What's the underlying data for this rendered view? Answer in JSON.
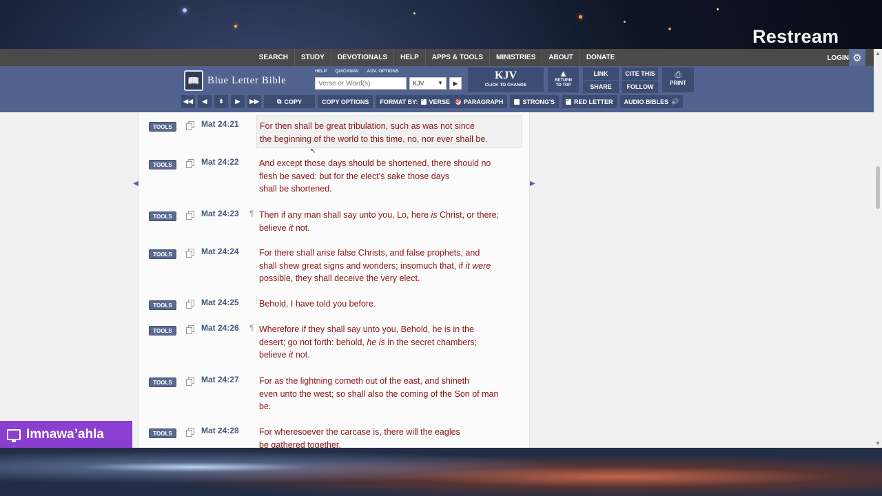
{
  "stream": {
    "brand": "Restream",
    "user_name": "Imnawa’ahla"
  },
  "nav": {
    "items": [
      "SEARCH",
      "STUDY",
      "DEVOTIONALS",
      "HELP",
      "APPS & TOOLS",
      "MINISTRIES",
      "ABOUT",
      "DONATE"
    ],
    "login": "LOGIN"
  },
  "header": {
    "logo_text": "Blue Letter Bible",
    "mini_links": [
      "HELP",
      "QUICKNAV",
      "ADV. OPTIONS"
    ],
    "search_placeholder": "Verse or Word(s)",
    "version_value": "KJV",
    "version_box": {
      "title": "KJV",
      "subtitle": "CLICK TO CHANGE"
    },
    "return_to_top": [
      "RETURN",
      "TO TOP"
    ],
    "link": "LINK",
    "share": "SHARE",
    "cite": "CITE THIS",
    "follow": "FOLLOW",
    "print": "PRINT"
  },
  "toolbar": {
    "copy": "COPY",
    "copy_options": "COPY OPTIONS",
    "format_by": "FORMAT BY:",
    "verse": "VERSE",
    "paragraph": "PARAGRAPH",
    "strongs": "STRONG'S",
    "red_letter": "RED LETTER",
    "audio_bibles": "AUDIO BIBLES"
  },
  "tools_label": "TOOLS",
  "verses": [
    {
      "ref": "Mat 24:21",
      "pilcrow": false,
      "lines": [
        "For then shall be great tribulation, such as was not since",
        "the beginning of the world to this time, no, nor ever shall be."
      ]
    },
    {
      "ref": "Mat 24:22",
      "pilcrow": false,
      "lines": [
        "And except those days should be shortened, there should no",
        "flesh be saved: but for the elect's sake those days",
        "shall be shortened."
      ]
    },
    {
      "ref": "Mat 24:23",
      "pilcrow": true,
      "lines": [
        "Then if any man shall say unto you, Lo, here <i>is</i> Christ, or there;",
        "believe <i>it</i> not."
      ]
    },
    {
      "ref": "Mat 24:24",
      "pilcrow": false,
      "lines": [
        "For there shall arise false Christs, and false prophets, and",
        "shall shew great signs and wonders; insomuch that, if <i>it were</i>",
        "possible, they shall deceive the very elect."
      ]
    },
    {
      "ref": "Mat 24:25",
      "pilcrow": false,
      "lines": [
        "Behold, I have told you before."
      ]
    },
    {
      "ref": "Mat 24:26",
      "pilcrow": true,
      "lines": [
        "Wherefore if they shall say unto you, Behold, he is in the",
        "desert; go not forth: behold, <i>he is</i> in the secret chambers;",
        "believe <i>it</i> not."
      ]
    },
    {
      "ref": "Mat 24:27",
      "pilcrow": false,
      "lines": [
        "For as the lightning cometh out of the east, and shineth",
        "even unto the west; so shall also the coming of the Son of man",
        "be."
      ]
    },
    {
      "ref": "Mat 24:28",
      "pilcrow": false,
      "lines": [
        "For wheresoever the carcase is, there will the eagles",
        "be gathered together."
      ]
    }
  ]
}
